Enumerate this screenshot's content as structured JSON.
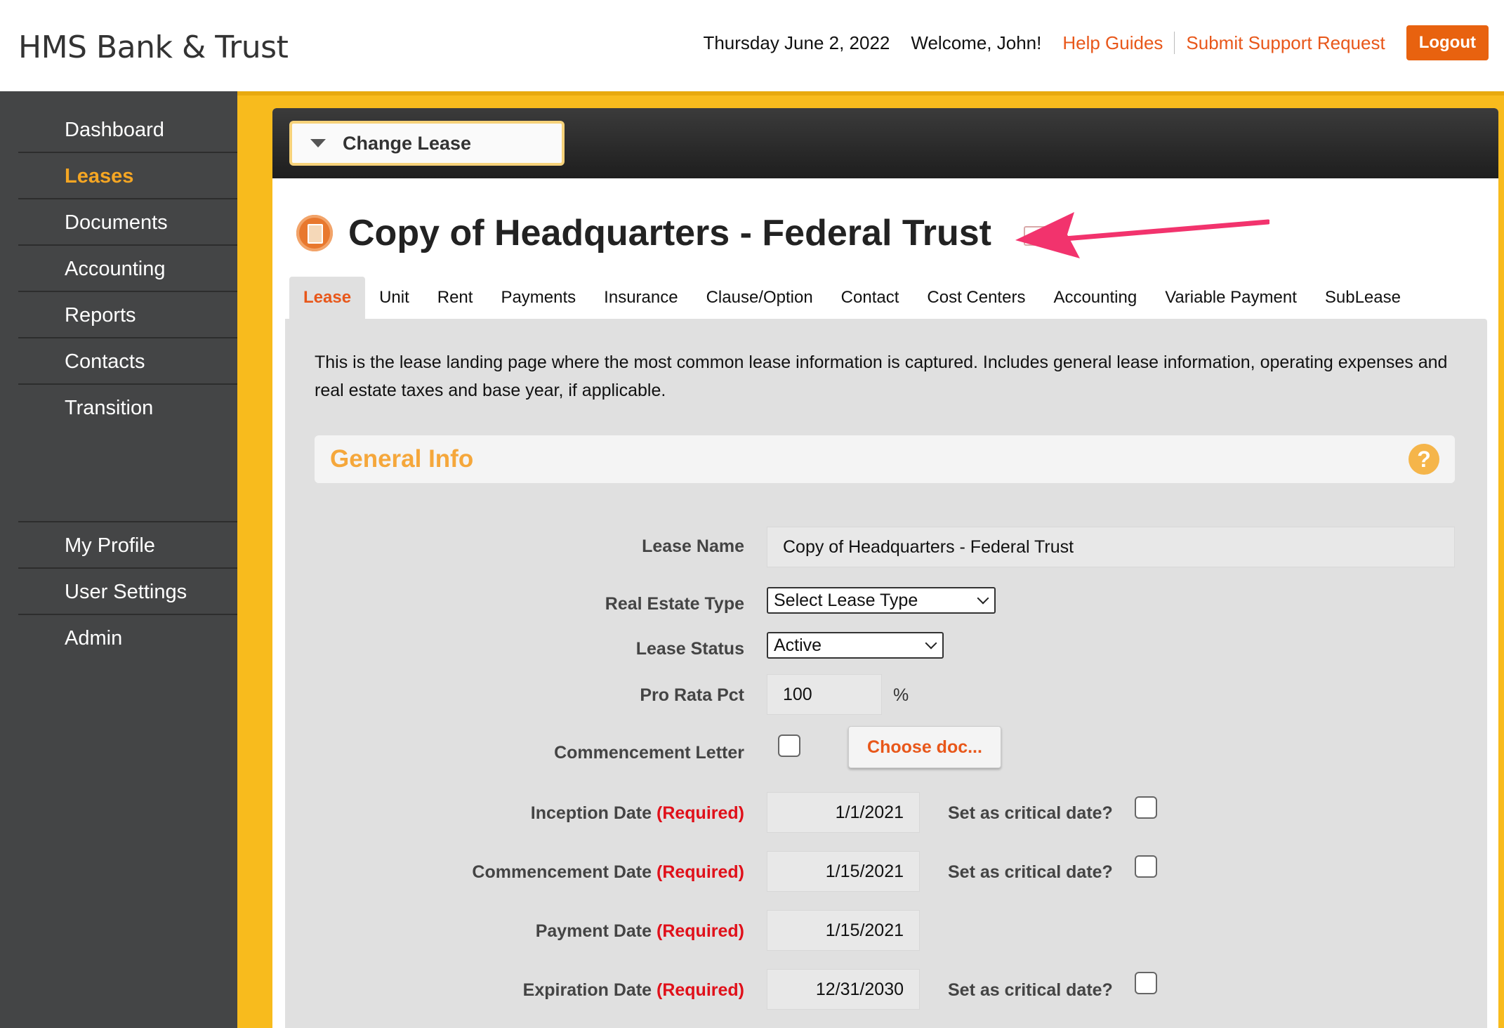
{
  "header": {
    "brand": "HMS Bank & Trust",
    "date": "Thursday June 2, 2022",
    "welcome": "Welcome, John!",
    "help_guides": "Help Guides",
    "submit_support": "Submit Support Request",
    "logout": "Logout"
  },
  "sidebar": {
    "items": [
      {
        "label": "Dashboard"
      },
      {
        "label": "Leases"
      },
      {
        "label": "Documents"
      },
      {
        "label": "Accounting"
      },
      {
        "label": "Reports"
      },
      {
        "label": "Contacts"
      },
      {
        "label": "Transition"
      }
    ],
    "active": "Leases",
    "bottom_items": [
      {
        "label": "My Profile"
      },
      {
        "label": "User Settings"
      },
      {
        "label": "Admin"
      }
    ]
  },
  "panel": {
    "change_lease": "Change Lease",
    "title": "Copy of Headquarters - Federal Trust"
  },
  "tabs": [
    {
      "label": "Lease"
    },
    {
      "label": "Unit"
    },
    {
      "label": "Rent"
    },
    {
      "label": "Payments"
    },
    {
      "label": "Insurance"
    },
    {
      "label": "Clause/Option"
    },
    {
      "label": "Contact"
    },
    {
      "label": "Cost Centers"
    },
    {
      "label": "Accounting"
    },
    {
      "label": "Variable Payment"
    },
    {
      "label": "SubLease"
    }
  ],
  "active_tab": "Lease",
  "description": "This is the lease landing page where the most common lease information is captured. Includes general lease information, operating expenses and real estate taxes and base year, if applicable.",
  "section": {
    "title": "General Info",
    "help": "?"
  },
  "form": {
    "lease_name_label": "Lease Name",
    "lease_name_value": "Copy of Headquarters - Federal Trust",
    "real_estate_type_label": "Real Estate Type",
    "real_estate_type_value": "Select Lease Type",
    "lease_status_label": "Lease Status",
    "lease_status_value": "Active",
    "pro_rata_label": "Pro Rata Pct",
    "pro_rata_value": "100",
    "pro_rata_unit": "%",
    "commencement_letter_label": "Commencement Letter",
    "commencement_letter_checked": false,
    "choose_doc": "Choose doc...",
    "required_text": "(Required)",
    "critical_label": "Set as critical date?",
    "inception_label": "Inception Date",
    "inception_value": "1/1/2021",
    "commencement_label": "Commencement Date",
    "commencement_value": "1/15/2021",
    "payment_label": "Payment Date",
    "payment_value": "1/15/2021",
    "expiration_label": "Expiration Date",
    "expiration_value": "12/31/2030"
  },
  "colors": {
    "accent_orange": "#e8571a",
    "frame_yellow": "#f8bb1d",
    "sidebar_bg": "#444546",
    "section_title": "#f5a73b",
    "required_red": "#e0101a",
    "annotation_arrow": "#f2336d"
  }
}
